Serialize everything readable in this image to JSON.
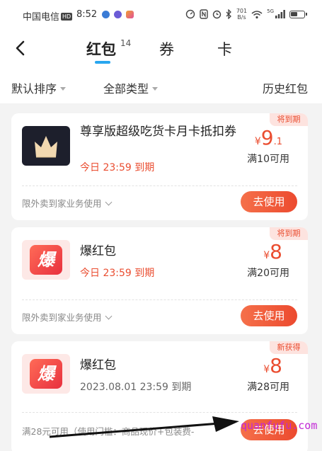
{
  "status_bar": {
    "carrier": "中国电信",
    "hd": "HD",
    "time": "8:52",
    "net_speed_value": "701",
    "net_speed_unit": "B/s",
    "signal": "5G"
  },
  "nav": {
    "tabs": [
      {
        "label": "红包",
        "count": "14",
        "active": true
      },
      {
        "label": "券",
        "active": false
      },
      {
        "label": "卡",
        "active": false
      }
    ]
  },
  "filters": {
    "sort": "默认排序",
    "type": "全部类型",
    "history": "历史红包"
  },
  "cards": [
    {
      "badge": "将到期",
      "title": "尊享版超级吃货卡月卡抵扣券",
      "date": "今日 23:59 到期",
      "currency": "¥",
      "amount": "9",
      "decimal": ".1",
      "condition": "满10可用",
      "footer": "限外卖到家业务使用",
      "button": "去使用"
    },
    {
      "badge": "将到期",
      "title": "爆红包",
      "thumb_text": "爆",
      "date": "今日 23:59 到期",
      "currency": "¥",
      "amount": "8",
      "condition": "满20可用",
      "footer": "限外卖到家业务使用",
      "button": "去使用"
    },
    {
      "badge": "新获得",
      "title": "爆红包",
      "thumb_text": "爆",
      "date": "2023.08.01 23:59 到期",
      "currency": "¥",
      "amount": "8",
      "condition": "满28可用",
      "footer": "满28元可用（使用门槛：商品现价+包装费-",
      "button": "去使用"
    }
  ],
  "watermark": "quanfufu.com",
  "colors": {
    "accent": "#ea4d30",
    "tab_indicator": "#28a6ef",
    "badge_bg": "#fde3df"
  }
}
